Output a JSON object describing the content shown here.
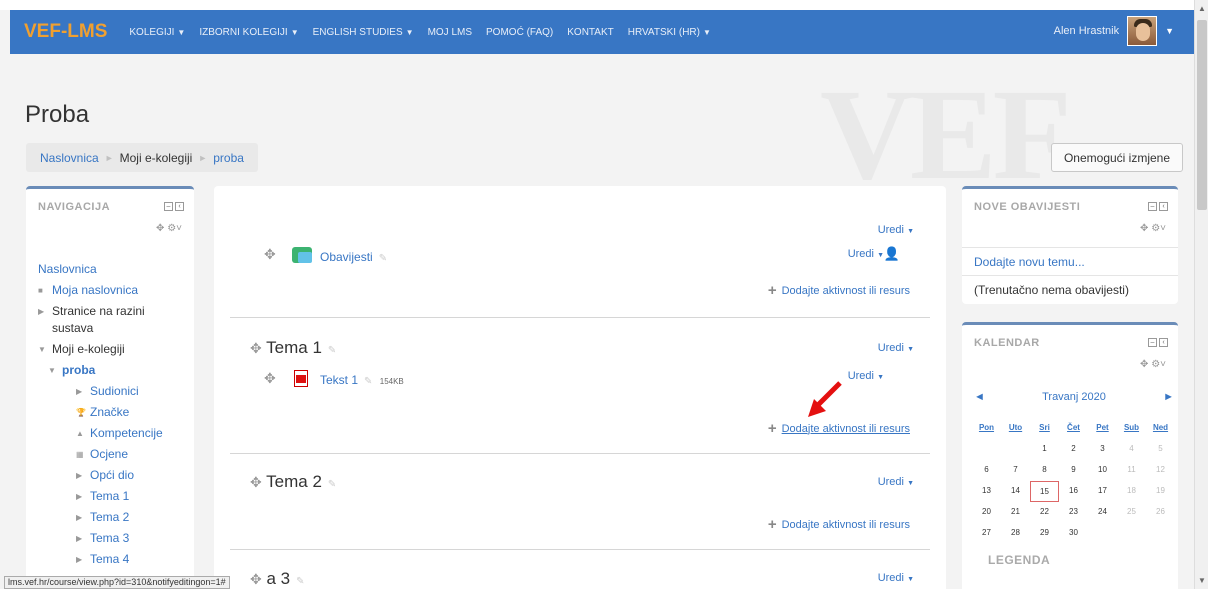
{
  "navbar": {
    "brand": "VEF-LMS",
    "menu": [
      {
        "label": "KOLEGIJI",
        "dropdown": true
      },
      {
        "label": "IZBORNI KOLEGIJI",
        "dropdown": true
      },
      {
        "label": "ENGLISH STUDIES",
        "dropdown": true
      },
      {
        "label": "MOJ LMS",
        "dropdown": false
      },
      {
        "label": "POMOĆ (FAQ)",
        "dropdown": false
      },
      {
        "label": "KONTAKT",
        "dropdown": false
      },
      {
        "label": "HRVATSKI (HR)",
        "dropdown": true
      }
    ],
    "user_name": "Alen Hrastnik"
  },
  "page": {
    "title": "Proba",
    "edit_button": "Onemogući izmjene"
  },
  "breadcrumb": [
    "Naslovnica",
    "Moji e-kolegiji",
    "proba"
  ],
  "navigation": {
    "title": "NAVIGACIJA",
    "items": [
      "Naslovnica",
      "Moja naslovnica",
      "Stranice na razini",
      "sustava",
      "Moji e-kolegiji",
      "proba",
      "Sudionici",
      "Značke",
      "Kompetencije",
      "Ocjene",
      "Opći dio",
      "Tema 1",
      "Tema 2",
      "Tema 3",
      "Tema 4"
    ]
  },
  "course": {
    "edit_label": "Uredi",
    "add_label": "Dodajte aktivnost ili resurs",
    "general": {
      "forum_name": "Obavijesti"
    },
    "topics": [
      {
        "title": "Tema 1",
        "resource": "Tekst 1",
        "size": "154KB"
      },
      {
        "title": "Tema 2"
      },
      {
        "title": "Tema 3",
        "visible_title": "a 3"
      }
    ]
  },
  "news": {
    "title": "NOVE OBAVIJESTI",
    "add_topic": "Dodajte novu temu...",
    "empty": "(Trenutačno nema obavijesti)"
  },
  "calendar": {
    "title": "KALENDAR",
    "month": "Travanj 2020",
    "prev": "◄",
    "next": "►",
    "days": [
      "Pon",
      "Uto",
      "Sri",
      "Čet",
      "Pet",
      "Sub",
      "Ned"
    ],
    "weeks": [
      [
        "",
        "",
        "1",
        "2",
        "3",
        "4",
        "5"
      ],
      [
        "6",
        "7",
        "8",
        "9",
        "10",
        "11",
        "12"
      ],
      [
        "13",
        "14",
        "15",
        "16",
        "17",
        "18",
        "19"
      ],
      [
        "20",
        "21",
        "22",
        "23",
        "24",
        "25",
        "26"
      ],
      [
        "27",
        "28",
        "29",
        "30",
        "",
        "",
        ""
      ]
    ],
    "today": "15",
    "legend": "LEGENDA"
  },
  "status_bar": "lms.vef.hr/course/view.php?id=310&notifyeditingon=1#",
  "colors": {
    "navbar": "#3876c4",
    "brand": "#f0a030",
    "link": "#3876c4"
  }
}
